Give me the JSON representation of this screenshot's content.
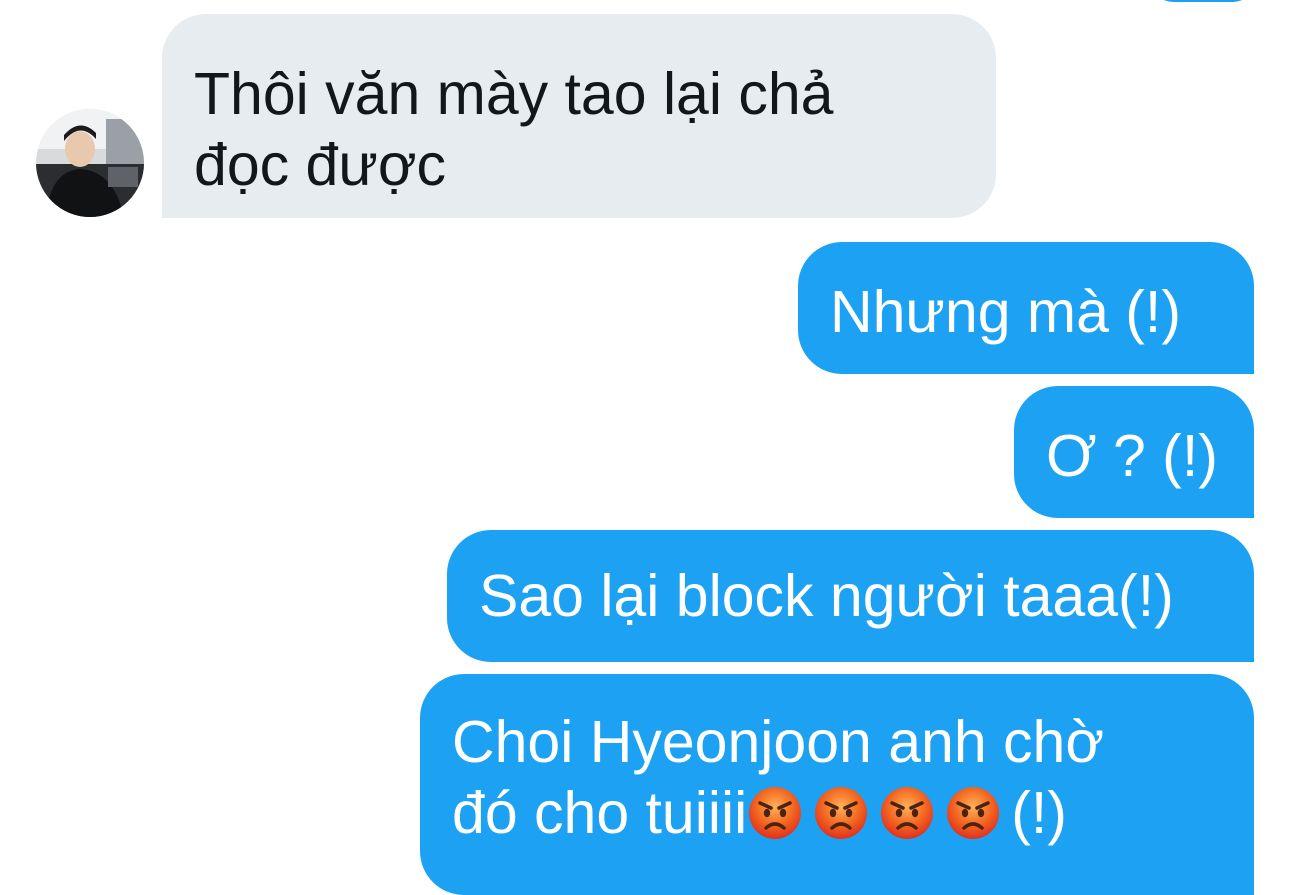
{
  "colors": {
    "incoming_bubble": "#e6ecf0",
    "incoming_text": "#14171a",
    "outgoing_bubble": "#1da1f2",
    "outgoing_text": "#ffffff"
  },
  "incoming": {
    "avatar_icon": "user-avatar",
    "lines": [
      "Thôi văn mày tao lại chả",
      "đọc được"
    ]
  },
  "outgoing": [
    {
      "text": "Nhưng mà (!)"
    },
    {
      "text": "Ơ ? (!)"
    },
    {
      "text": "Sao lại block người taaa(!)"
    },
    {
      "line1": "Choi Hyeonjoon anh chờ",
      "line2_text": "đó cho tuiiii",
      "emoji": "pouting-face-emoji",
      "emoji_count": 4,
      "line2_suffix": "(!)"
    }
  ]
}
